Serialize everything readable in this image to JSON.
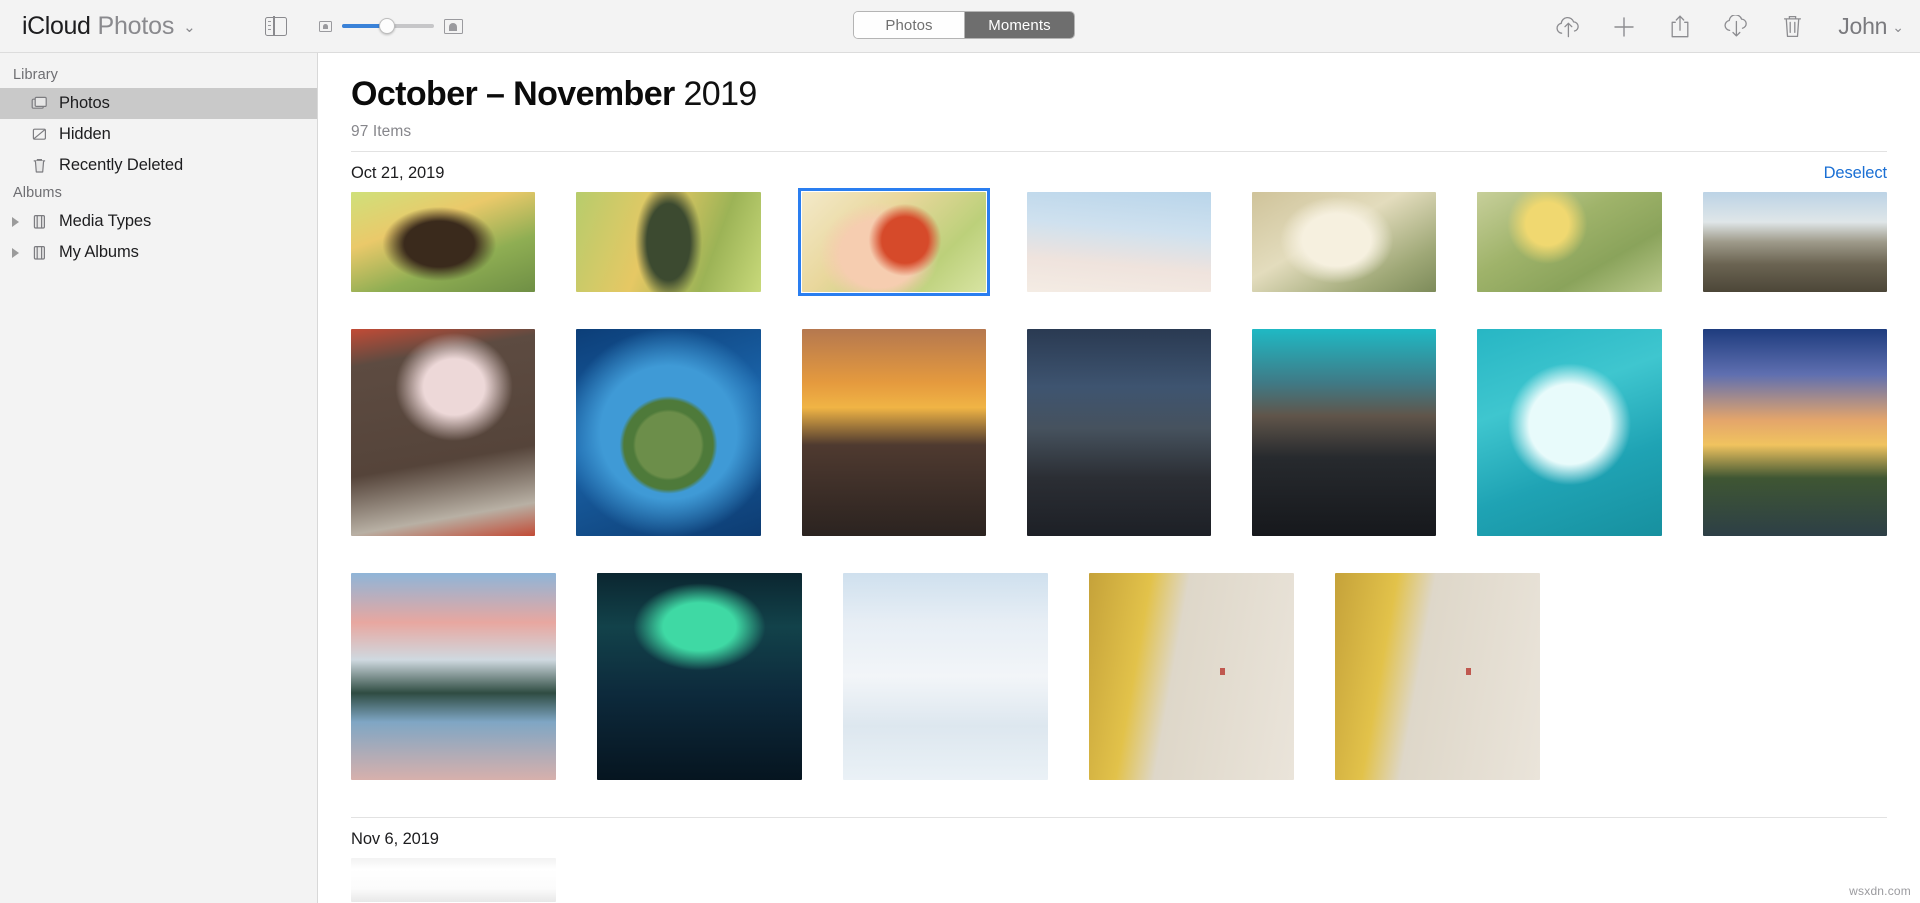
{
  "toolbar": {
    "brand_icloud": "iCloud",
    "brand_app": "Photos",
    "brand_caret": "⌄",
    "sidebar_toggle_name": "sidebar-toggle",
    "zoom_min_label": "small-thumbnail-icon",
    "zoom_max_label": "large-thumbnail-icon",
    "zoom_value": 46,
    "segments": [
      {
        "label": "Photos",
        "selected": false
      },
      {
        "label": "Moments",
        "selected": true
      }
    ],
    "actions": [
      {
        "name": "upload-icon",
        "title": "Upload"
      },
      {
        "name": "plus-icon",
        "title": "Add"
      },
      {
        "name": "share-icon",
        "title": "Share"
      },
      {
        "name": "download-icon",
        "title": "Download"
      },
      {
        "name": "trash-icon",
        "title": "Delete"
      }
    ],
    "user": "John",
    "user_caret": "⌄"
  },
  "sidebar": {
    "sections": [
      {
        "title": "Library",
        "items": [
          {
            "label": "Photos",
            "icon": "photos-icon",
            "selected": true,
            "arrow": false
          },
          {
            "label": "Hidden",
            "icon": "hidden-icon",
            "selected": false,
            "arrow": false
          },
          {
            "label": "Recently Deleted",
            "icon": "trash-icon",
            "selected": false,
            "arrow": false
          }
        ]
      },
      {
        "title": "Albums",
        "items": [
          {
            "label": "Media Types",
            "icon": "album-icon",
            "selected": false,
            "arrow": true
          },
          {
            "label": "My Albums",
            "icon": "album-icon",
            "selected": false,
            "arrow": true
          }
        ]
      }
    ]
  },
  "main": {
    "title_bold": "October – November",
    "title_light": "2019",
    "item_count": "97 Items",
    "days": [
      {
        "date": "Oct 21, 2019",
        "action_label": "Deselect",
        "rows": [
          [
            {
              "name": "photo-autumn-shed",
              "art": "p-autumn-shed",
              "shape": "land",
              "selected": false
            },
            {
              "name": "photo-ivy-tree",
              "art": "p-ivy-tree",
              "shape": "land",
              "selected": false
            },
            {
              "name": "photo-maple-leaf-hand",
              "art": "p-maple-hand",
              "shape": "land",
              "selected": true
            },
            {
              "name": "photo-soft-sky",
              "art": "p-sky-blur",
              "shape": "land",
              "selected": false
            },
            {
              "name": "photo-white-rose",
              "art": "p-white-rose",
              "shape": "land",
              "selected": false
            },
            {
              "name": "photo-yellow-rose",
              "art": "p-yellow-rose",
              "shape": "land",
              "selected": false
            },
            {
              "name": "photo-desert-road",
              "art": "p-road-desert",
              "shape": "land",
              "selected": false
            }
          ],
          [
            {
              "name": "photo-blossom-window",
              "art": "p-blossom-wall",
              "shape": "port",
              "selected": false
            },
            {
              "name": "photo-tiny-planet",
              "art": "p-tiny-planet",
              "shape": "port",
              "selected": false
            },
            {
              "name": "photo-sunset-street",
              "art": "p-sunset-street",
              "shape": "port",
              "selected": false
            },
            {
              "name": "photo-night-city-street",
              "art": "p-night-city",
              "shape": "port",
              "selected": false
            },
            {
              "name": "photo-teal-skyline",
              "art": "p-teal-sky-city",
              "shape": "port",
              "selected": false
            },
            {
              "name": "photo-heart-island",
              "art": "p-heart-island",
              "shape": "port",
              "selected": false
            },
            {
              "name": "photo-eiffel-tower",
              "art": "p-eiffel",
              "shape": "port",
              "selected": false
            }
          ],
          [
            {
              "name": "photo-pink-lake",
              "art": "p-pink-lake",
              "shape": "port",
              "selected": false
            },
            {
              "name": "photo-aurora",
              "art": "p-aurora",
              "shape": "port",
              "selected": false
            },
            {
              "name": "photo-snow-forest",
              "art": "p-snow-forest",
              "shape": "port",
              "selected": false
            },
            {
              "name": "photo-ginkgo-wall-a",
              "art": "p-ginkgo-wall",
              "shape": "port",
              "selected": false
            },
            {
              "name": "photo-ginkgo-wall-b",
              "art": "p-ginkgo-wall",
              "shape": "port",
              "selected": false
            }
          ]
        ]
      },
      {
        "date": "Nov 6, 2019",
        "action_label": "",
        "rows": [
          [
            {
              "name": "photo-macbook-desk",
              "art": "p-macbook",
              "shape": "cut",
              "selected": false
            }
          ]
        ]
      }
    ]
  },
  "watermark": "wsxdn.com"
}
